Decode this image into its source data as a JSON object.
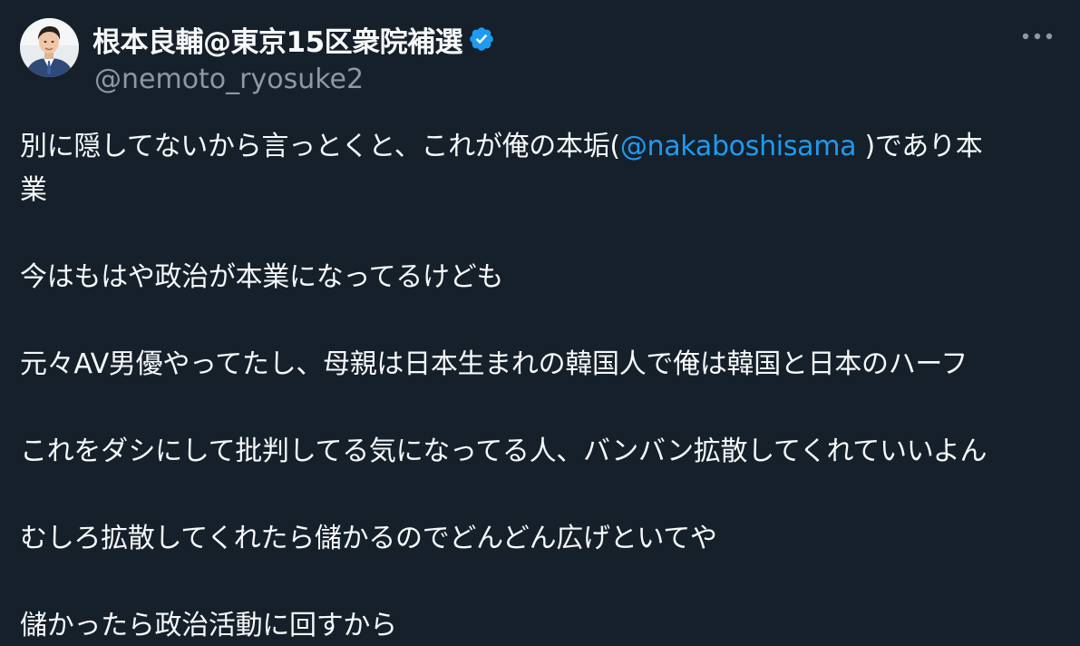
{
  "author": {
    "display_name": "根本良輔@東京15区衆院補選",
    "handle": "@nemoto_ryosuke2",
    "avatar_icon": "profile-photo",
    "verified_icon": "verified-badge-icon"
  },
  "more_icon": "more-options-icon",
  "colors": {
    "background": "#15202b",
    "text": "#f7f9f9",
    "secondary_text": "#8b98a5",
    "link": "#1d9bf0",
    "verified": "#1d9bf0"
  },
  "tweet": {
    "line1_before": "別に隠してないから言っとくと、これが俺の本垢(",
    "mention": "@nakaboshisama",
    "line1_after": " )であり本",
    "line1_wrap": "業",
    "para2": "今はもはや政治が本業になってるけども",
    "para3": "元々AV男優やってたし、母親は日本生まれの韓国人で俺は韓国と日本のハーフ",
    "para4": "これをダシにして批判してる気になってる人、バンバン拡散してくれていいよん",
    "para5": "むしろ拡散してくれたら儲かるのでどんどん広げといてや",
    "para6": "儲かったら政治活動に回すから"
  }
}
